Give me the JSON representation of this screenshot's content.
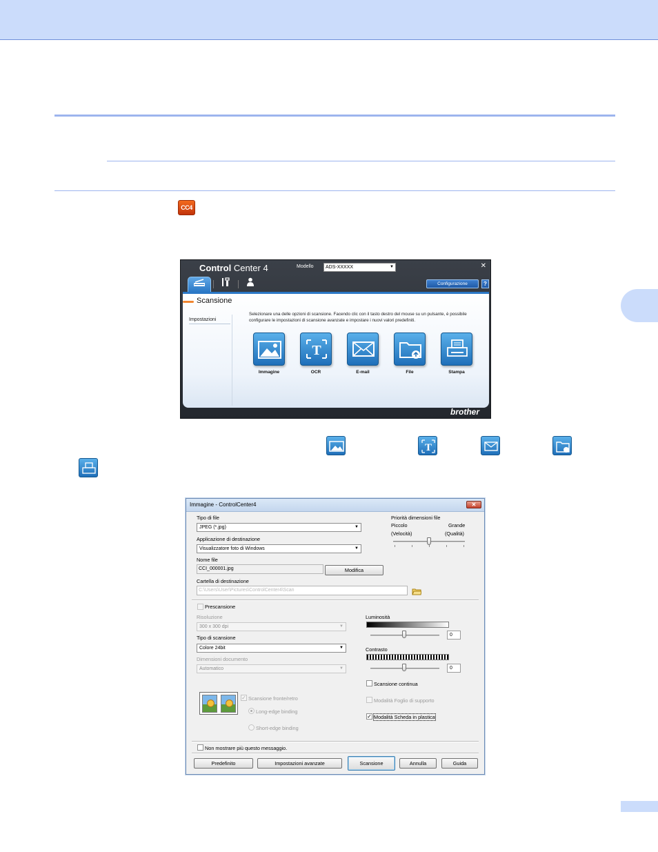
{
  "cc4_icon_text": "CC4",
  "cc4_window": {
    "title_bold": "Control",
    "title_rest": " Center 4",
    "model_label": "Modello",
    "model_value": "ADS-XXXXX",
    "close": "✕",
    "config_button": "Configurazione",
    "help_button": "?",
    "section_title": "Scansione",
    "sidebar_item": "Impostazioni",
    "description": "Selezionare una delle opzioni di scansione. Facendo clic con il tasto destro del mouse su un pulsante, è possibile configurare le impostazioni di scansione avanzate e impostare i nuovi valori predefiniti.",
    "buttons": [
      "Immagine",
      "OCR",
      "E-mail",
      "File",
      "Stampa"
    ],
    "brand": "brother"
  },
  "dialog": {
    "title": "Immagine - ControlCenter4",
    "close": "✕",
    "file_type_label": "Tipo di file",
    "file_type_value": "JPEG (*.jpg)",
    "size_priority_label": "Priorità dimensioni file",
    "small_label": "Piccolo",
    "small_sub": "(Velocità)",
    "large_label": "Grande",
    "large_sub": "(Qualità)",
    "dest_app_label": "Applicazione di destinazione",
    "dest_app_value": "Visualizzatore foto di Windows",
    "file_name_label": "Nome file",
    "file_name_value": "CCI_000001.jpg",
    "modify_button": "Modifica",
    "dest_folder_label": "Cartella di destinazione",
    "dest_folder_value": "C:\\Users\\User\\Pictures\\ControlCenter4\\Scan",
    "prescan_label": "Prescansione",
    "resolution_label": "Risoluzione",
    "resolution_value": "300 x 300 dpi",
    "scan_type_label": "Tipo di scansione",
    "scan_type_value": "Colore 24bit",
    "doc_size_label": "Dimensioni documento",
    "doc_size_value": "Automatico",
    "brightness_label": "Luminosità",
    "brightness_value": "0",
    "contrast_label": "Contrasto",
    "contrast_value": "0",
    "continuous_label": "Scansione continua",
    "carrier_sheet_label": "Modalità Foglio di supporto",
    "plastic_card_label": "Modalità Scheda in plastica",
    "duplex_label": "Scansione fronte/retro",
    "long_edge_label": "Long-edge binding",
    "short_edge_label": "Short-edge binding",
    "dont_show_label": "Non mostrare più questo messaggio.",
    "buttons": {
      "default": "Predefinito",
      "advanced": "Impostazioni avanzate",
      "scan": "Scansione",
      "cancel": "Annulla",
      "help": "Guida"
    }
  }
}
